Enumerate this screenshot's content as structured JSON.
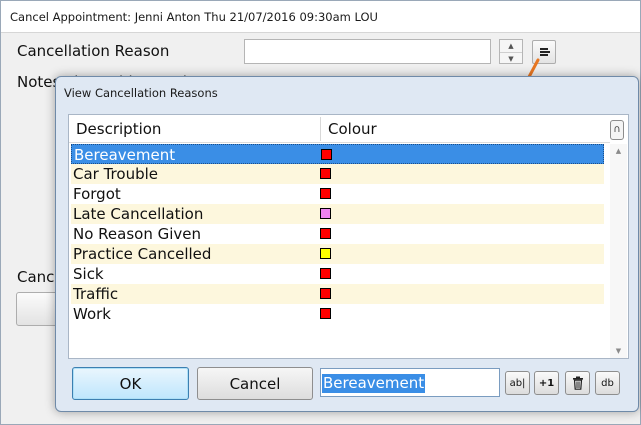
{
  "parent_window": {
    "title": "Cancel Appointment: Jenni Anton Thu 21/07/2016 09:30am LOU",
    "cancellation_reason_label": "Cancellation Reason",
    "notes_label": "Notes about this appointment",
    "cancelled_by_label_partial": "Canc",
    "cancellation_reason_value": ""
  },
  "dialog": {
    "title": "View Cancellation Reasons",
    "columns": [
      "Description",
      "Colour"
    ],
    "rows": [
      {
        "description": "Bereavement",
        "colour": "#ff0000",
        "selected": true
      },
      {
        "description": "Car Trouble",
        "colour": "#ff0000",
        "selected": false
      },
      {
        "description": "Forgot",
        "colour": "#ff0000",
        "selected": false
      },
      {
        "description": "Late Cancellation",
        "colour": "#ee82ee",
        "selected": false
      },
      {
        "description": "No Reason Given",
        "colour": "#ff0000",
        "selected": false
      },
      {
        "description": "Practice Cancelled",
        "colour": "#ffff00",
        "selected": false
      },
      {
        "description": "Sick",
        "colour": "#ff0000",
        "selected": false
      },
      {
        "description": "Traffic",
        "colour": "#ff0000",
        "selected": false
      },
      {
        "description": "Work",
        "colour": "#ff0000",
        "selected": false
      }
    ],
    "ok_label": "OK",
    "cancel_label": "Cancel",
    "edit_value": "Bereavement",
    "tools": [
      {
        "name": "edit-button",
        "label": "ab|"
      },
      {
        "name": "increment-button",
        "label": "+1"
      },
      {
        "name": "delete-button",
        "label": "trash-icon"
      },
      {
        "name": "database-button",
        "label": "db"
      }
    ]
  },
  "colors": {
    "selection": "#3a8ee6",
    "alt_row": "#fdf7dd",
    "annotation_arrow": "#e87722"
  }
}
